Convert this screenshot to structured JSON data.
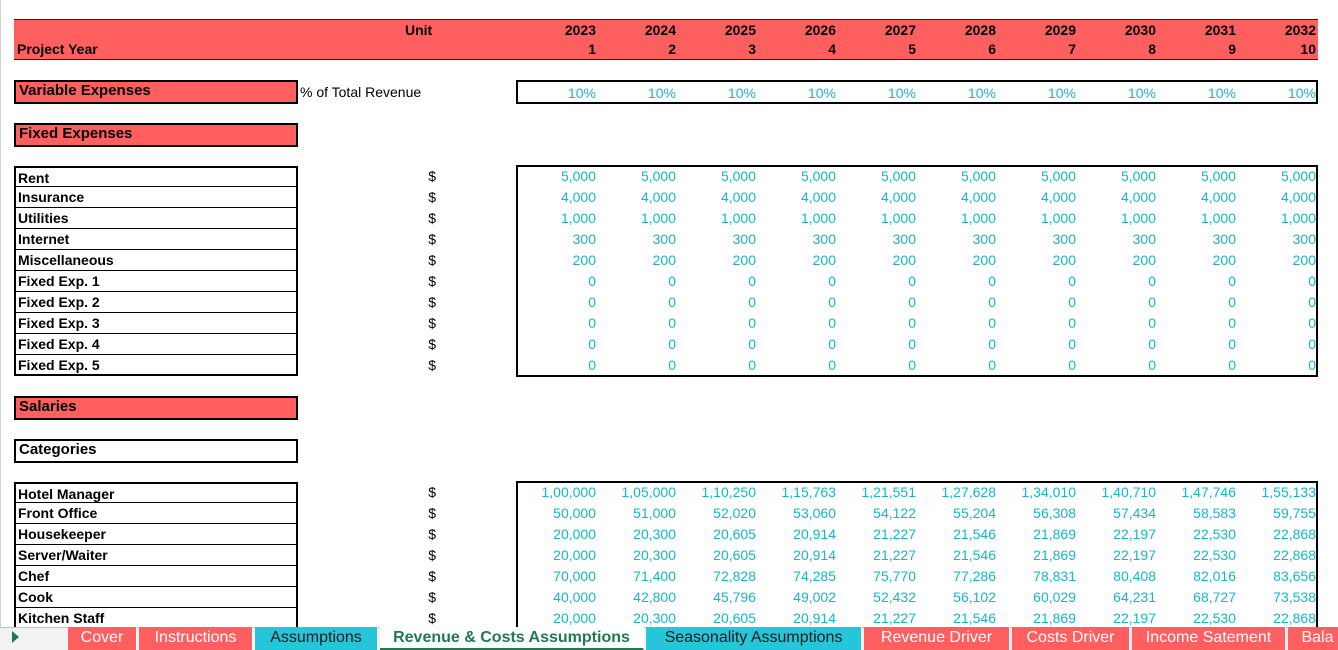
{
  "header": {
    "project_year_label": "Project Year",
    "unit_label": "Unit",
    "years": [
      "2023",
      "2024",
      "2025",
      "2026",
      "2027",
      "2028",
      "2029",
      "2030",
      "2031",
      "2032"
    ],
    "year_index": [
      "1",
      "2",
      "3",
      "4",
      "5",
      "6",
      "7",
      "8",
      "9",
      "10"
    ]
  },
  "variable_expenses": {
    "title": "Variable Expenses",
    "unit": "% of Total Revenue",
    "values": [
      "10%",
      "10%",
      "10%",
      "10%",
      "10%",
      "10%",
      "10%",
      "10%",
      "10%",
      "10%"
    ]
  },
  "fixed_expenses": {
    "title": "Fixed Expenses",
    "rows": [
      {
        "label": "Rent",
        "unit": "$",
        "values": [
          "5,000",
          "5,000",
          "5,000",
          "5,000",
          "5,000",
          "5,000",
          "5,000",
          "5,000",
          "5,000",
          "5,000"
        ]
      },
      {
        "label": "Insurance",
        "unit": "$",
        "values": [
          "4,000",
          "4,000",
          "4,000",
          "4,000",
          "4,000",
          "4,000",
          "4,000",
          "4,000",
          "4,000",
          "4,000"
        ]
      },
      {
        "label": "Utilities",
        "unit": "$",
        "values": [
          "1,000",
          "1,000",
          "1,000",
          "1,000",
          "1,000",
          "1,000",
          "1,000",
          "1,000",
          "1,000",
          "1,000"
        ]
      },
      {
        "label": "Internet",
        "unit": "$",
        "values": [
          "300",
          "300",
          "300",
          "300",
          "300",
          "300",
          "300",
          "300",
          "300",
          "300"
        ]
      },
      {
        "label": "Miscellaneous",
        "unit": "$",
        "values": [
          "200",
          "200",
          "200",
          "200",
          "200",
          "200",
          "200",
          "200",
          "200",
          "200"
        ]
      },
      {
        "label": "Fixed Exp. 1",
        "unit": "$",
        "values": [
          "0",
          "0",
          "0",
          "0",
          "0",
          "0",
          "0",
          "0",
          "0",
          "0"
        ]
      },
      {
        "label": "Fixed Exp. 2",
        "unit": "$",
        "values": [
          "0",
          "0",
          "0",
          "0",
          "0",
          "0",
          "0",
          "0",
          "0",
          "0"
        ]
      },
      {
        "label": "Fixed Exp. 3",
        "unit": "$",
        "values": [
          "0",
          "0",
          "0",
          "0",
          "0",
          "0",
          "0",
          "0",
          "0",
          "0"
        ]
      },
      {
        "label": "Fixed Exp. 4",
        "unit": "$",
        "values": [
          "0",
          "0",
          "0",
          "0",
          "0",
          "0",
          "0",
          "0",
          "0",
          "0"
        ]
      },
      {
        "label": "Fixed Exp. 5",
        "unit": "$",
        "values": [
          "0",
          "0",
          "0",
          "0",
          "0",
          "0",
          "0",
          "0",
          "0",
          "0"
        ]
      }
    ]
  },
  "salaries": {
    "title": "Salaries",
    "categories_label": "Categories",
    "rows": [
      {
        "label": "Hotel Manager",
        "unit": "$",
        "values": [
          "1,00,000",
          "1,05,000",
          "1,10,250",
          "1,15,763",
          "1,21,551",
          "1,27,628",
          "1,34,010",
          "1,40,710",
          "1,47,746",
          "1,55,133"
        ]
      },
      {
        "label": "Front Office",
        "unit": "$",
        "values": [
          "50,000",
          "51,000",
          "52,020",
          "53,060",
          "54,122",
          "55,204",
          "56,308",
          "57,434",
          "58,583",
          "59,755"
        ]
      },
      {
        "label": "Housekeeper",
        "unit": "$",
        "values": [
          "20,000",
          "20,300",
          "20,605",
          "20,914",
          "21,227",
          "21,546",
          "21,869",
          "22,197",
          "22,530",
          "22,868"
        ]
      },
      {
        "label": "Server/Waiter",
        "unit": "$",
        "values": [
          "20,000",
          "20,300",
          "20,605",
          "20,914",
          "21,227",
          "21,546",
          "21,869",
          "22,197",
          "22,530",
          "22,868"
        ]
      },
      {
        "label": "Chef",
        "unit": "$",
        "values": [
          "70,000",
          "71,400",
          "72,828",
          "74,285",
          "75,770",
          "77,286",
          "78,831",
          "80,408",
          "82,016",
          "83,656"
        ]
      },
      {
        "label": "Cook",
        "unit": "$",
        "values": [
          "40,000",
          "42,800",
          "45,796",
          "49,002",
          "52,432",
          "56,102",
          "60,029",
          "64,231",
          "68,727",
          "73,538"
        ]
      },
      {
        "label": "Kitchen Staff",
        "unit": "$",
        "values": [
          "20,000",
          "20,300",
          "20,605",
          "20,914",
          "21,227",
          "21,546",
          "21,869",
          "22,197",
          "22,530",
          "22,868"
        ]
      }
    ]
  },
  "tabs": [
    {
      "label": "Cover",
      "style": "red"
    },
    {
      "label": "Instructions",
      "style": "red"
    },
    {
      "label": "Assumptions",
      "style": "cyan"
    },
    {
      "label": "Revenue & Costs Assumptions",
      "style": "active"
    },
    {
      "label": "Seasonality Assumptions",
      "style": "cyan"
    },
    {
      "label": "Revenue Driver",
      "style": "red"
    },
    {
      "label": "Costs Driver",
      "style": "red"
    },
    {
      "label": "Income Satement",
      "style": "red"
    },
    {
      "label": "Bala",
      "style": "red"
    }
  ],
  "colors": {
    "section_fill": "#ff5f5f",
    "value_text": "#14b8c8",
    "cyan_tab": "#26c6da",
    "active_tab_text": "#1f7a4d"
  }
}
